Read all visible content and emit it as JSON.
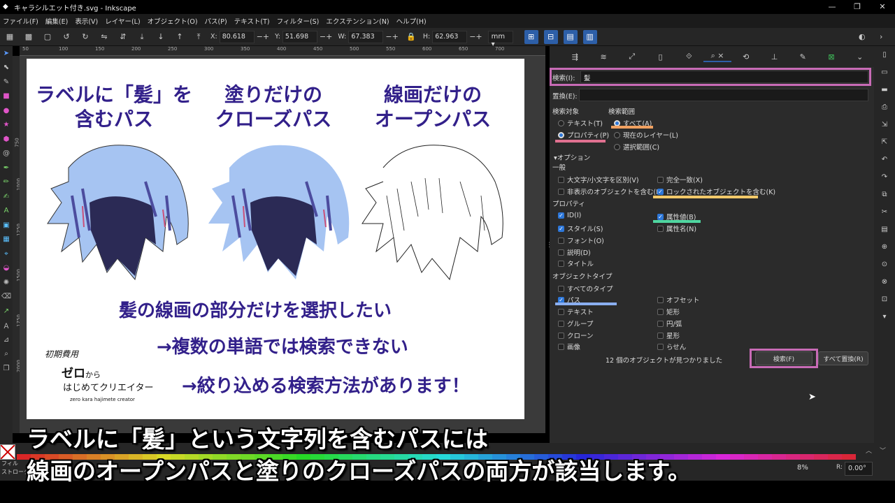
{
  "window": {
    "title": "キャラシルエット付き.svg - Inkscape",
    "controls": [
      "—",
      "❐",
      "✕"
    ]
  },
  "menu": [
    "ファイル(F)",
    "編集(E)",
    "表示(V)",
    "レイヤー(L)",
    "オブジェクト(O)",
    "パス(P)",
    "テキスト(T)",
    "フィルター(S)",
    "エクステンション(N)",
    "ヘルプ(H)"
  ],
  "toolcontrols": {
    "x_label": "X:",
    "x_value": "80.618",
    "y_label": "Y:",
    "y_value": "51.698",
    "w_label": "W:",
    "w_value": "67.383",
    "h_label": "H:",
    "h_value": "62.963",
    "unit": "mm ▾"
  },
  "ruler": {
    "top": [
      "50",
      "100",
      "150",
      "200",
      "250",
      "300",
      "350",
      "400",
      "450",
      "500",
      "550",
      "600",
      "650",
      "700"
    ],
    "left": [
      "750",
      "1000",
      "1250",
      "1500",
      "1750",
      "2000"
    ]
  },
  "canvas": {
    "heading1": [
      "ラベルに「髪」を",
      "含むパス"
    ],
    "heading2": [
      "塗りだけの",
      "クローズパス"
    ],
    "heading3": [
      "線画だけの",
      "オープンパス"
    ],
    "message1": "髪の線画の部分だけを選択したい",
    "message2": "→複数の単語では検索できない",
    "message3": "→絞り込める検索方法があります！",
    "logo": {
      "line1": "初期費用",
      "line2": "ゼロ",
      "line2_small": "から",
      "line3": "はじめてクリエイター",
      "line4": "zero kara hajimete creator"
    }
  },
  "colors": {
    "accent": "#2d5fa8",
    "heading_text": "#32208a",
    "highlight_box": "#c86bb6",
    "hair_fill": "#a6c4f2",
    "hair_shadow": "#4c4c9e"
  },
  "panel": {
    "search_label": "検索(I):",
    "search_value": "髪",
    "replace_label": "置換(E):",
    "replace_value": "",
    "search_in_label": "検索対象",
    "scope_label": "検索範囲",
    "search_in": {
      "text": "テキスト(T)",
      "properties": "プロパティ(P)"
    },
    "scope": {
      "all": "すべて(A)",
      "current_layer": "現在のレイヤー(L)",
      "selection": "選択範囲(C)"
    },
    "options_label": "▾オプション",
    "general_label": "一般",
    "case_sensitive": "大文字/小文字を区別(V)",
    "exact_match": "完全一致(X)",
    "include_hidden": "非表示のオブジェクトを含む(H)",
    "include_locked": "ロックされたオブジェクトを含む(K)",
    "properties_label": "プロパティ",
    "props": {
      "id": "ID(I)",
      "attr_value": "属性値(B)",
      "style": "スタイル(S)",
      "attr_name": "属性名(N)",
      "font": "フォント(O)",
      "desc": "説明(D)",
      "title": "タイトル"
    },
    "object_types_label": "オブジェクトタイプ",
    "types": {
      "all": "すべてのタイプ",
      "path": "パス",
      "offset": "オフセット",
      "text": "テキスト",
      "rect": "矩形",
      "group": "グループ",
      "ellipse": "円/弧",
      "clone": "クローン",
      "star": "星形",
      "image": "画像",
      "spiral": "らせん"
    },
    "result_text": "12 個のオブジェクトが見つかりました",
    "find_button": "検索(F)",
    "replace_all_button": "すべて置換(R)"
  },
  "status": {
    "fill_label": "フィル",
    "stroke_label": "ストローク",
    "zoom": "8%",
    "rotation_label": "R:",
    "rotation_value": "0.00°"
  },
  "subtitle": {
    "line1": "ラベルに「髪」という文字列を含むパスには",
    "line2": "線画のオープンパスと塗りのクローズパスの両方が該当します。"
  }
}
